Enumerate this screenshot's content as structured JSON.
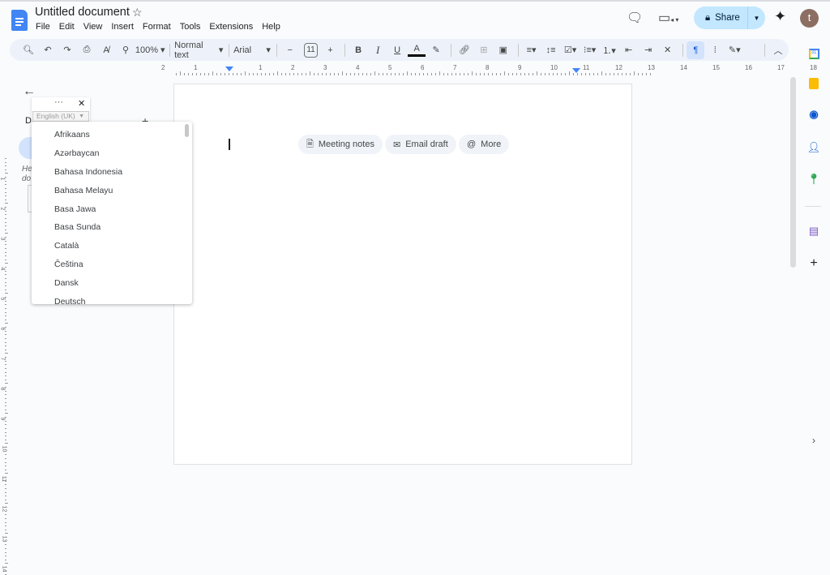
{
  "header": {
    "title": "Untitled document",
    "menu": [
      "File",
      "Edit",
      "View",
      "Insert",
      "Format",
      "Tools",
      "Extensions",
      "Help"
    ],
    "share_label": "Share",
    "avatar_initial": "t"
  },
  "toolbar": {
    "zoom": "100%",
    "style": "Normal text",
    "font": "Arial",
    "font_size": "11"
  },
  "ruler": {
    "labels": [
      "2",
      "1",
      "1",
      "2",
      "3",
      "4",
      "5",
      "6",
      "7",
      "8",
      "9",
      "10",
      "11",
      "12",
      "13",
      "14",
      "15",
      "16",
      "17",
      "18"
    ]
  },
  "vruler": {
    "labels": [
      "1",
      "2",
      "3",
      "4",
      "5",
      "6",
      "7",
      "8",
      "9",
      "10",
      "11",
      "12",
      "13",
      "14"
    ]
  },
  "sidebar": {
    "tabs_initial": "D",
    "hint_text": [
      "He",
      "do"
    ]
  },
  "chips": [
    {
      "label": "Meeting notes",
      "icon": "document-icon"
    },
    {
      "label": "Email draft",
      "icon": "email-icon"
    },
    {
      "label": "More",
      "icon": "at-icon"
    }
  ],
  "language_popup": {
    "selected": "English (UK)",
    "options": [
      "Afrikaans",
      "Azərbaycan",
      "Bahasa Indonesia",
      "Bahasa Melayu",
      "Basa Jawa",
      "Basa Sunda",
      "Català",
      "Čeština",
      "Dansk",
      "Deutsch"
    ]
  },
  "colors": {
    "accent": "#0b57d0",
    "share_bg": "#c2e7ff",
    "toolbar_bg": "#edf2fa",
    "avatar": "#8d6e63"
  }
}
